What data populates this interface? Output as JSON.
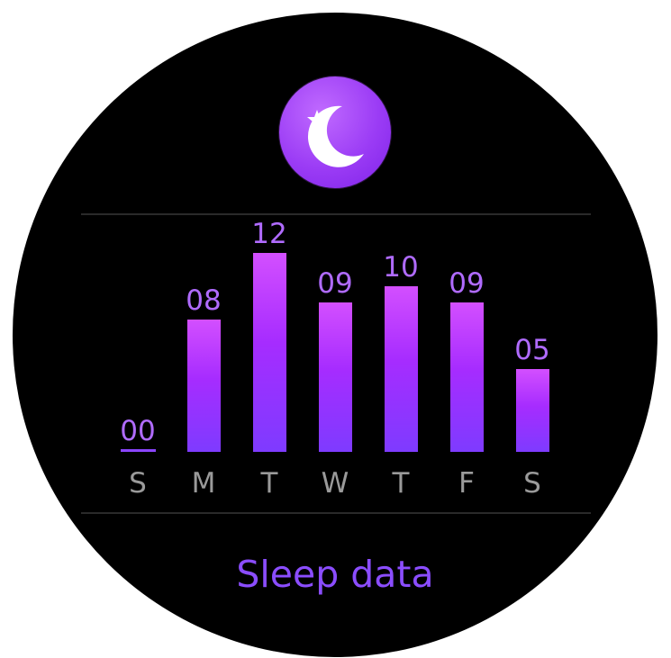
{
  "app": {
    "title": "Sleep data",
    "icon": "moon-star-icon"
  },
  "colors": {
    "background": "#000000",
    "accent": "#8b4dff",
    "bar_top": "#d34fff",
    "bar_bottom": "#7e3bff",
    "value_text": "#b06bff",
    "day_text": "#9a9a9a"
  },
  "chart_data": {
    "type": "bar",
    "categories": [
      "S",
      "M",
      "T",
      "W",
      "T",
      "F",
      "S"
    ],
    "values": [
      0,
      8,
      12,
      9,
      10,
      9,
      5
    ],
    "data_labels": [
      "00",
      "08",
      "12",
      "09",
      "10",
      "09",
      "05"
    ],
    "title": "Sleep data",
    "xlabel": "",
    "ylabel": "",
    "ylim": [
      0,
      12
    ],
    "grid": false
  }
}
